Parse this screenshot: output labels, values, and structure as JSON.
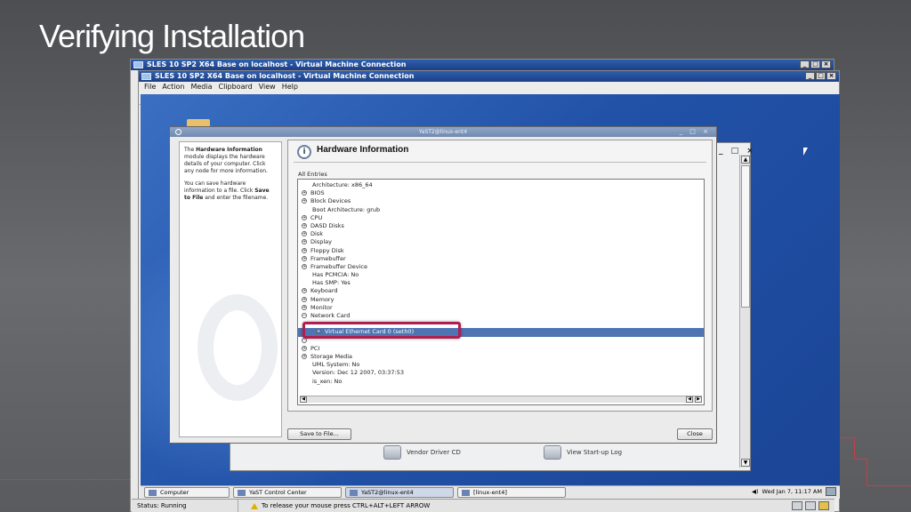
{
  "slide": {
    "title": "Verifying Installation"
  },
  "outer_window": {
    "title": "SLES 10 SP2 X64 Base on localhost - Virtual Machine Connection"
  },
  "inner_window": {
    "title": "SLES 10 SP2 X64 Base on localhost - Virtual Machine Connection",
    "menu": [
      "File",
      "Action",
      "Media",
      "Clipboard",
      "View",
      "Help"
    ]
  },
  "yast": {
    "window_title": "YaST2@linux-ent4",
    "help_html_parts": {
      "p1_pre": "The ",
      "p1_bold": "Hardware Information",
      "p1_post": " module displays the hardware details of your computer. Click any node for more information.",
      "p2_pre": "You can save hardware information to a file. Click ",
      "p2_bold": "Save to File",
      "p2_post": " and enter the filename."
    },
    "heading": "Hardware Information",
    "all_entries_label": "All Entries",
    "tree": [
      {
        "label": "Architecture: x86_64",
        "expandable": false
      },
      {
        "label": "BIOS",
        "expandable": true,
        "sign": "+"
      },
      {
        "label": "Block Devices",
        "expandable": true,
        "sign": "+"
      },
      {
        "label": "Boot Architecture: grub",
        "expandable": false
      },
      {
        "label": "CPU",
        "expandable": true,
        "sign": "+"
      },
      {
        "label": "DASD Disks",
        "expandable": true,
        "sign": "+"
      },
      {
        "label": "Disk",
        "expandable": true,
        "sign": "+"
      },
      {
        "label": "Display",
        "expandable": true,
        "sign": "+"
      },
      {
        "label": "Floppy Disk",
        "expandable": true,
        "sign": "+"
      },
      {
        "label": "Framebuffer",
        "expandable": true,
        "sign": "+"
      },
      {
        "label": "Framebuffer Device",
        "expandable": true,
        "sign": "+"
      },
      {
        "label": "Has PCMCIA: No",
        "expandable": false
      },
      {
        "label": "Has SMP: Yes",
        "expandable": false
      },
      {
        "label": "Keyboard",
        "expandable": true,
        "sign": "+"
      },
      {
        "label": "Memory",
        "expandable": true,
        "sign": "+"
      },
      {
        "label": "Monitor",
        "expandable": true,
        "sign": "+"
      },
      {
        "label": "Network Card",
        "expandable": true,
        "sign": "−"
      },
      {
        "label": "",
        "expandable": false,
        "obscured": true
      },
      {
        "label": "Virtual Ethernet Card 0 (seth0)",
        "expandable": true,
        "sign": "+",
        "child": true,
        "selected": true
      },
      {
        "label": "",
        "expandable": true,
        "sign": "+",
        "obscured": true
      },
      {
        "label": "PCI",
        "expandable": true,
        "sign": "+"
      },
      {
        "label": "Storage Media",
        "expandable": true,
        "sign": "+"
      },
      {
        "label": "UML System: No",
        "expandable": false
      },
      {
        "label": "Version: Dec 12 2007, 03:37:53",
        "expandable": false
      },
      {
        "label": "is_xen: No",
        "expandable": false
      }
    ],
    "save_button": "Save to File...",
    "close_button": "Close"
  },
  "background_window": {
    "items": [
      {
        "label": "Vendor Driver CD"
      },
      {
        "label": "View Start-up Log"
      }
    ]
  },
  "taskbar": {
    "tasks": [
      {
        "label": "Computer"
      },
      {
        "label": "YaST Control Center"
      },
      {
        "label": "YaST2@linux-ent4",
        "active": true
      },
      {
        "label": "[linux-ent4]"
      }
    ],
    "clock": "Wed Jan 7, 11:17 AM"
  },
  "statusbar": {
    "status": "Status: Running",
    "message": "To release your mouse press CTRL+ALT+LEFT ARROW"
  },
  "colors": {
    "highlight_border": "#b01e50",
    "selection": "#4f74b2",
    "titlebar": "#2f5fae"
  }
}
